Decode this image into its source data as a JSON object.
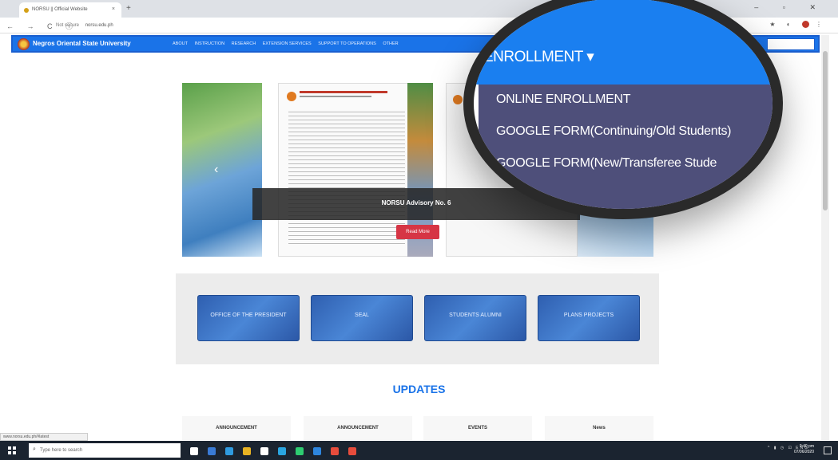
{
  "browser": {
    "tab_title": "NORSU || Official Website",
    "tab_close": "×",
    "new_tab": "+",
    "window_controls": "– ▫ ✕",
    "nav_icons": "← → C ⓘ",
    "security_label": "Not secure",
    "url": "norsu.edu.ph",
    "status_url": "www.norsu.edu.ph/#latest"
  },
  "site_nav": {
    "brand": "Negros Oriental State University",
    "menu": [
      "ABOUT",
      "INSTRUCTION",
      "RESEARCH",
      "EXTENSION SERVICES",
      "SUPPORT TO OPERATIONS",
      "OTHER"
    ]
  },
  "carousel": {
    "caption": "NORSU Advisory No. 6",
    "read_more": "Read More",
    "prev_arrow": "‹"
  },
  "magnifier": {
    "menu_label": "ENROLLMENT ▾",
    "items": [
      "ONLINE ENROLLMENT",
      "GOOGLE FORM(Continuing/Old Students)",
      "GOOGLE FORM(New/Transferee Stude"
    ]
  },
  "quick_links": [
    "Office of the President",
    "Seal",
    "Students Alumni",
    "Plans Projects"
  ],
  "updates": {
    "title": "UPDATES",
    "cards": [
      "ANNOUNCEMENT",
      "ANNOUNCEMENT",
      "EVENTS",
      "News"
    ]
  },
  "taskbar": {
    "search_placeholder": "Type here to search",
    "tray": "^ ▮ ◷ ⊡ ENG",
    "time": "9:40 pm",
    "date": "07/06/2020",
    "app_colors": [
      "#ffffff",
      "#3a7bd5",
      "#2f9be0",
      "#e8b323",
      "#ffffff",
      "#2aa5e0",
      "#2ecc71",
      "#2e86de",
      "#e74c3c",
      "#e74c3c"
    ]
  },
  "colors": {
    "nav_blue": "#1a73e8",
    "dropdown": "#4e4f7a",
    "read_more": "#d63545"
  }
}
